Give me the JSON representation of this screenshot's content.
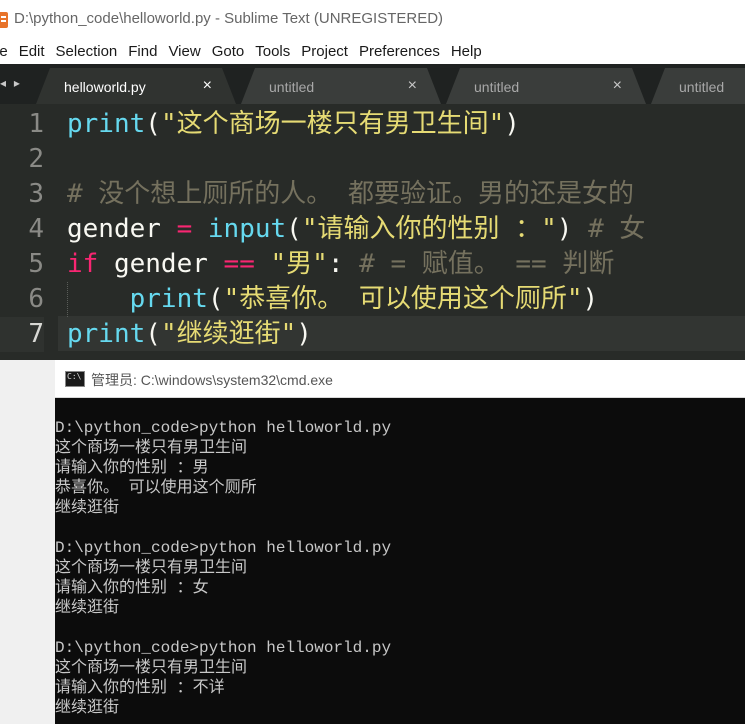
{
  "window": {
    "title": "D:\\python_code\\helloworld.py - Sublime Text (UNREGISTERED)"
  },
  "menu": [
    "le",
    "Edit",
    "Selection",
    "Find",
    "View",
    "Goto",
    "Tools",
    "Project",
    "Preferences",
    "Help"
  ],
  "nav_arrows": "◂ ▸",
  "tabs": [
    {
      "label": "helloworld.py",
      "close": "×",
      "active": true
    },
    {
      "label": "untitled",
      "close": "×",
      "active": false
    },
    {
      "label": "untitled",
      "close": "×",
      "active": false
    },
    {
      "label": "untitled",
      "close": "",
      "active": false
    }
  ],
  "editor": {
    "line_numbers": [
      "1",
      "2",
      "3",
      "4",
      "5",
      "6",
      "7"
    ],
    "current_line": 7,
    "lines": [
      [
        {
          "t": "fn",
          "v": "print"
        },
        {
          "t": "plain",
          "v": "("
        },
        {
          "t": "str",
          "v": "\"这个商场一楼只有男卫生间\""
        },
        {
          "t": "plain",
          "v": ")"
        }
      ],
      [],
      [
        {
          "t": "cmt",
          "v": "# 没个想上厕所的人。 都要验证。男的还是女的"
        }
      ],
      [
        {
          "t": "plain",
          "v": "gender "
        },
        {
          "t": "op",
          "v": "="
        },
        {
          "t": "plain",
          "v": " "
        },
        {
          "t": "fn",
          "v": "input"
        },
        {
          "t": "plain",
          "v": "("
        },
        {
          "t": "str",
          "v": "\"请输入你的性别 ：\""
        },
        {
          "t": "plain",
          "v": ") "
        },
        {
          "t": "cmt",
          "v": "# 女"
        }
      ],
      [
        {
          "t": "kw",
          "v": "if"
        },
        {
          "t": "plain",
          "v": " gender "
        },
        {
          "t": "op",
          "v": "=="
        },
        {
          "t": "plain",
          "v": " "
        },
        {
          "t": "str",
          "v": "\"男\""
        },
        {
          "t": "plain",
          "v": ": "
        },
        {
          "t": "cmt",
          "v": "# = 赋值。 == 判断"
        }
      ],
      [
        {
          "t": "plain",
          "v": "    "
        },
        {
          "t": "fn",
          "v": "print"
        },
        {
          "t": "plain",
          "v": "("
        },
        {
          "t": "str",
          "v": "\"恭喜你。 可以使用这个厕所\""
        },
        {
          "t": "plain",
          "v": ")"
        }
      ],
      [
        {
          "t": "fn",
          "v": "print"
        },
        {
          "t": "plain",
          "v": "("
        },
        {
          "t": "str",
          "v": "\"继续逛街\""
        },
        {
          "t": "plain",
          "v": ")"
        }
      ]
    ]
  },
  "cmd": {
    "title": "管理员: C:\\windows\\system32\\cmd.exe",
    "output": [
      "D:\\python_code>python helloworld.py",
      "这个商场一楼只有男卫生间",
      "请输入你的性别 ：男",
      "恭喜你。 可以使用这个厕所",
      "继续逛街",
      "",
      "D:\\python_code>python helloworld.py",
      "这个商场一楼只有男卫生间",
      "请输入你的性别 ：女",
      "继续逛街",
      "",
      "D:\\python_code>python helloworld.py",
      "这个商场一楼只有男卫生间",
      "请输入你的性别 ：不详",
      "继续逛街"
    ]
  }
}
